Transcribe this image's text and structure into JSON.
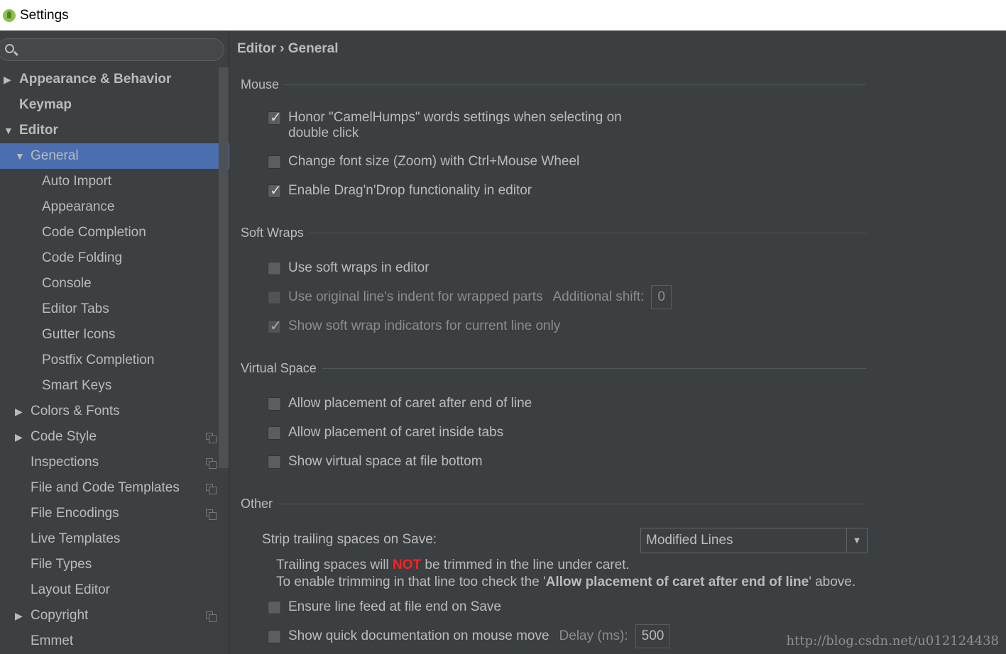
{
  "window": {
    "title": "Settings"
  },
  "sidebar": {
    "search_placeholder": "",
    "items": [
      {
        "label": "Appearance & Behavior",
        "level": 0,
        "arrow": "right",
        "bold": true
      },
      {
        "label": "Keymap",
        "level": 0,
        "arrow": "",
        "bold": true
      },
      {
        "label": "Editor",
        "level": 0,
        "arrow": "down",
        "bold": true
      },
      {
        "label": "General",
        "level": 1,
        "arrow": "down",
        "selected": true
      },
      {
        "label": "Auto Import",
        "level": 2
      },
      {
        "label": "Appearance",
        "level": 2
      },
      {
        "label": "Code Completion",
        "level": 2
      },
      {
        "label": "Code Folding",
        "level": 2
      },
      {
        "label": "Console",
        "level": 2
      },
      {
        "label": "Editor Tabs",
        "level": 2
      },
      {
        "label": "Gutter Icons",
        "level": 2
      },
      {
        "label": "Postfix Completion",
        "level": 2
      },
      {
        "label": "Smart Keys",
        "level": 2
      },
      {
        "label": "Colors & Fonts",
        "level": 1,
        "arrow": "right"
      },
      {
        "label": "Code Style",
        "level": 1,
        "arrow": "right",
        "copy": true
      },
      {
        "label": "Inspections",
        "level": 1,
        "copy": true
      },
      {
        "label": "File and Code Templates",
        "level": 1,
        "copy": true
      },
      {
        "label": "File Encodings",
        "level": 1,
        "copy": true
      },
      {
        "label": "Live Templates",
        "level": 1
      },
      {
        "label": "File Types",
        "level": 1
      },
      {
        "label": "Layout Editor",
        "level": 1
      },
      {
        "label": "Copyright",
        "level": 1,
        "arrow": "right",
        "copy": true
      },
      {
        "label": "Emmet",
        "level": 1
      }
    ]
  },
  "breadcrumb": "Editor › General",
  "sections": {
    "mouse": "Mouse",
    "soft_wraps": "Soft Wraps",
    "virtual_space": "Virtual Space",
    "other": "Other"
  },
  "options": {
    "camel": {
      "label": "Honor \"CamelHumps\" words settings when selecting on",
      "label2": "double click",
      "checked": true
    },
    "zoom": {
      "label": "Change font size (Zoom) with Ctrl+Mouse Wheel",
      "checked": false
    },
    "dnd": {
      "label": "Enable Drag'n'Drop functionality in editor",
      "checked": true
    },
    "softwrap": {
      "label": "Use soft wraps in editor",
      "checked": false
    },
    "indent": {
      "label": "Use original line's indent for wrapped parts",
      "shift_label": "Additional shift:",
      "shift_value": "0",
      "checked": false,
      "disabled": true
    },
    "indicators": {
      "label": "Show soft wrap indicators for current line only",
      "checked": true,
      "disabled": true
    },
    "caret_eol": {
      "label": "Allow placement of caret after end of line",
      "checked": false
    },
    "caret_tabs": {
      "label": "Allow placement of caret inside tabs",
      "checked": false
    },
    "virtual_bottom": {
      "label": "Show virtual space at file bottom",
      "checked": false
    },
    "linefeed": {
      "label": "Ensure line feed at file end on Save",
      "checked": false
    },
    "quickdoc": {
      "label": "Show quick documentation on mouse move",
      "delay_label": "Delay (ms):",
      "delay_value": "500",
      "checked": false
    }
  },
  "strip": {
    "label": "Strip trailing spaces on Save:",
    "value": "Modified Lines",
    "note1a": "Trailing spaces will ",
    "note1b": "NOT",
    "note1c": " be trimmed in the line under caret.",
    "note2a": "To enable trimming in that line too check the '",
    "note2b": "Allow placement of caret after end of line",
    "note2c": "' above."
  },
  "watermark": "http://blog.csdn.net/u012124438",
  "colors": {
    "selection": "#4b6eaf",
    "warning": "#ff2020"
  }
}
